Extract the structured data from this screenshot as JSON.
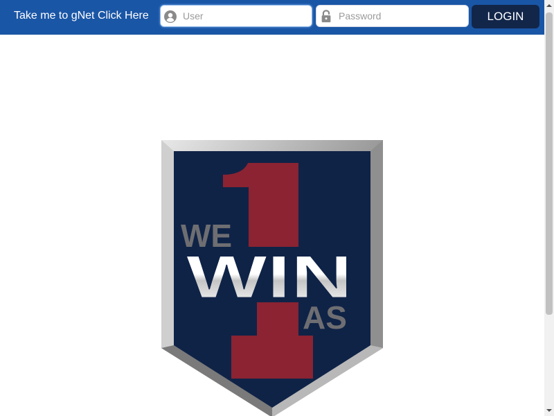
{
  "header": {
    "gnet_link": "Take me to gNet Click Here",
    "user_placeholder": "User",
    "password_placeholder": "Password",
    "login_label": "LOGIN"
  },
  "logo": {
    "word_we": "WE",
    "word_win": "WIN",
    "word_as": "AS",
    "colors": {
      "navy": "#0f2347",
      "red": "#8b2332",
      "gray": "#6e6e72",
      "silver": "#c9c9c9"
    }
  },
  "icons": {
    "user_field": "user-avatar-icon",
    "password_field": "padlock-icon"
  }
}
